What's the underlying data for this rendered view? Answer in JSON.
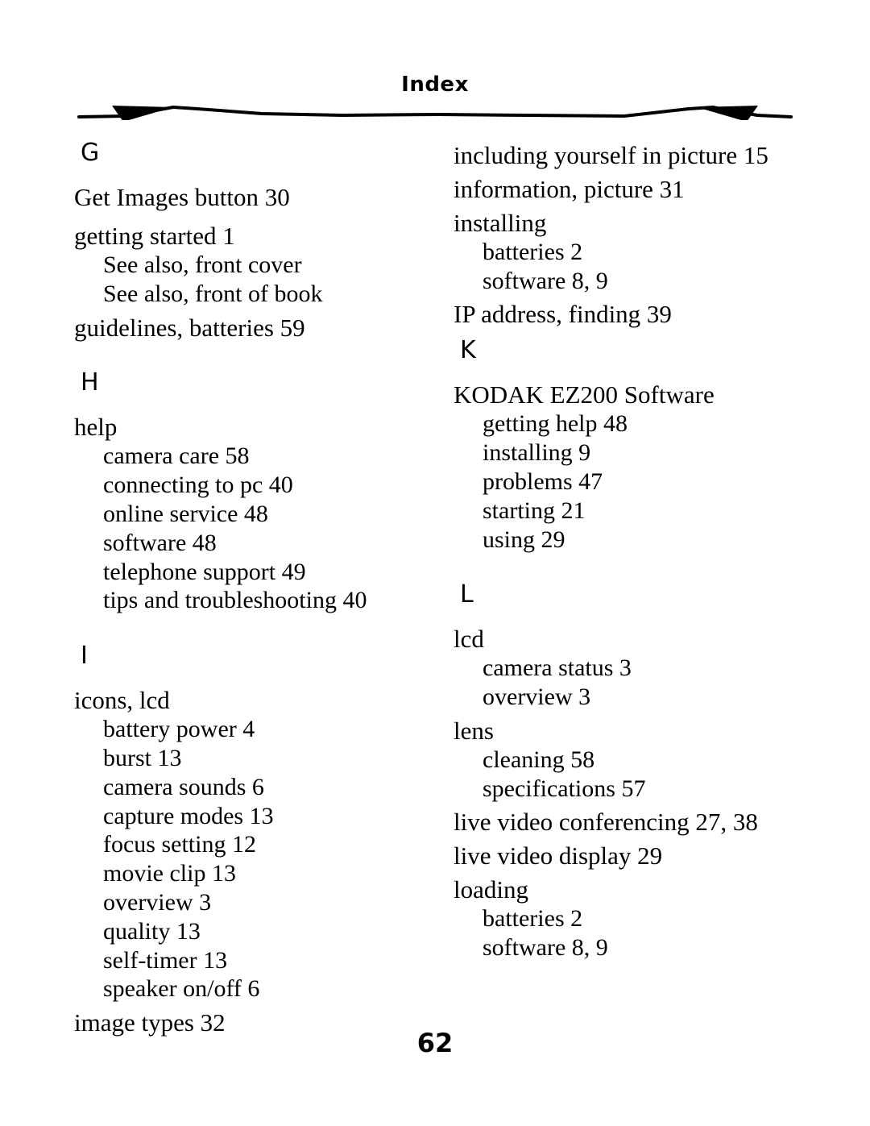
{
  "header": {
    "title": "Index",
    "rule_color": "#000000"
  },
  "footer": {
    "page_number": "62"
  },
  "left_column": {
    "sections": [
      {
        "letter": "G",
        "entries": [
          {
            "level": 1,
            "text": "Get Images button 30"
          },
          {
            "level": 1,
            "text": "getting started 1"
          },
          {
            "level": 2,
            "text": "See also, front cover"
          },
          {
            "level": 2,
            "text": "See also, front of book"
          },
          {
            "level": 1,
            "text": "guidelines, batteries 59"
          }
        ]
      },
      {
        "letter": "H",
        "entries": [
          {
            "level": 1,
            "text": "help"
          },
          {
            "level": 2,
            "text": "camera care 58"
          },
          {
            "level": 2,
            "text": "connecting to pc 40"
          },
          {
            "level": 2,
            "text": "online service 48"
          },
          {
            "level": 2,
            "text": "software 48"
          },
          {
            "level": 2,
            "text": "telephone support 49"
          },
          {
            "level": 2,
            "text": "tips and troubleshooting 40"
          }
        ]
      },
      {
        "letter": "I",
        "entries": [
          {
            "level": 1,
            "text": "icons, lcd"
          },
          {
            "level": 2,
            "text": "battery power 4"
          },
          {
            "level": 2,
            "text": "burst 13"
          },
          {
            "level": 2,
            "text": "camera sounds 6"
          },
          {
            "level": 2,
            "text": "capture modes 13"
          },
          {
            "level": 2,
            "text": "focus setting 12"
          },
          {
            "level": 2,
            "text": "movie clip 13"
          },
          {
            "level": 2,
            "text": "overview 3"
          },
          {
            "level": 2,
            "text": "quality 13"
          },
          {
            "level": 2,
            "text": "self-timer 13"
          },
          {
            "level": 2,
            "text": "speaker on/off 6"
          },
          {
            "level": 1,
            "text": "image types 32"
          }
        ]
      }
    ]
  },
  "right_column": {
    "sections": [
      {
        "letter": "",
        "entries": [
          {
            "level": 1,
            "text": "including yourself in picture 15"
          },
          {
            "level": 1,
            "text": "information, picture 31"
          },
          {
            "level": 1,
            "text": "installing"
          },
          {
            "level": 2,
            "text": "batteries 2"
          },
          {
            "level": 2,
            "text": "software 8, 9"
          },
          {
            "level": 1,
            "text": "IP address, finding 39"
          }
        ]
      },
      {
        "letter": "K",
        "entries": [
          {
            "level": 1,
            "text": "KODAK EZ200 Software"
          },
          {
            "level": 2,
            "text": "getting help 48"
          },
          {
            "level": 2,
            "text": "installing 9"
          },
          {
            "level": 2,
            "text": "problems 47"
          },
          {
            "level": 2,
            "text": "starting 21"
          },
          {
            "level": 2,
            "text": "using 29"
          }
        ]
      },
      {
        "letter": "L",
        "entries": [
          {
            "level": 1,
            "text": "lcd"
          },
          {
            "level": 2,
            "text": "camera status 3"
          },
          {
            "level": 2,
            "text": "overview 3"
          },
          {
            "level": 1,
            "text": "lens"
          },
          {
            "level": 2,
            "text": "cleaning 58"
          },
          {
            "level": 2,
            "text": "specifications 57"
          },
          {
            "level": 1,
            "text": "live video conferencing 27, 38"
          },
          {
            "level": 1,
            "text": "live video display 29"
          },
          {
            "level": 1,
            "text": "loading"
          },
          {
            "level": 2,
            "text": "batteries 2"
          },
          {
            "level": 2,
            "text": "software 8, 9"
          }
        ]
      }
    ]
  }
}
